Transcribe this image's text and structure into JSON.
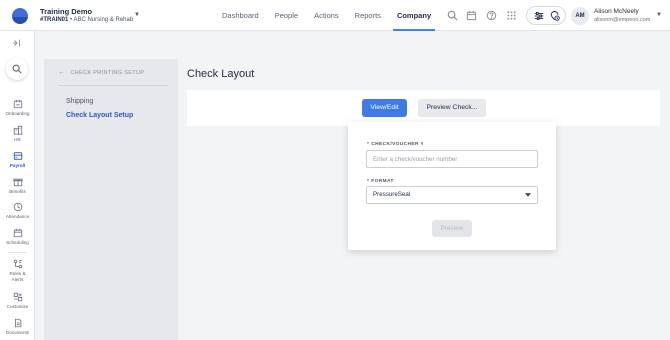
{
  "header": {
    "org_title": "Training Demo",
    "org_code": "#TRAIN01",
    "org_separator": "•",
    "org_name": "ABC Nursing & Rehab",
    "nav": [
      {
        "label": "Dashboard",
        "active": false
      },
      {
        "label": "People",
        "active": false
      },
      {
        "label": "Actions",
        "active": false
      },
      {
        "label": "Reports",
        "active": false
      },
      {
        "label": "Company",
        "active": true
      }
    ],
    "icons": [
      "search-icon",
      "calendar-icon",
      "help-icon",
      "apps-grid-icon",
      "sliders-icon",
      "location-clock-icon"
    ],
    "user": {
      "initials": "AM",
      "name": "Alison McNeely",
      "email": "alisonm@empeon.com"
    }
  },
  "sidebar": {
    "items": [
      {
        "label": "Onboarding",
        "icon": "onboarding-icon",
        "active": false
      },
      {
        "label": "HR",
        "icon": "hr-icon",
        "active": false
      },
      {
        "label": "Payroll",
        "icon": "payroll-icon",
        "active": true
      },
      {
        "label": "Benefits",
        "icon": "benefits-icon",
        "active": false
      },
      {
        "label": "Attendance",
        "icon": "attendance-icon",
        "active": false
      },
      {
        "label": "Scheduling",
        "icon": "scheduling-icon",
        "active": false
      },
      {
        "label": "Rules &",
        "label2": "Alerts",
        "icon": "rules-alerts-icon",
        "active": false
      },
      {
        "label": "Customize",
        "icon": "customize-icon",
        "active": false
      },
      {
        "label": "Documents",
        "icon": "documents-icon",
        "active": false
      }
    ]
  },
  "subnav": {
    "back_label": "CHECK PRINTING SETUP",
    "items": [
      {
        "label": "Shipping",
        "active": false
      },
      {
        "label": "Check Layout Setup",
        "active": true
      }
    ]
  },
  "main": {
    "title": "Check Layout",
    "view_edit_label": "View/Edit",
    "preview_check_label": "Preview Check...",
    "popover": {
      "required_marker": "*",
      "voucher_label": "CHECK/VOUCHER #",
      "voucher_placeholder": "Enter a check/voucher number",
      "voucher_value": "",
      "format_label": "FORMAT",
      "format_value": "PressureSeal",
      "preview_label": "Preview"
    }
  },
  "colors": {
    "accent": "#3f7be6",
    "active_nav": "#2f56c8",
    "required": "#d62d2d"
  }
}
